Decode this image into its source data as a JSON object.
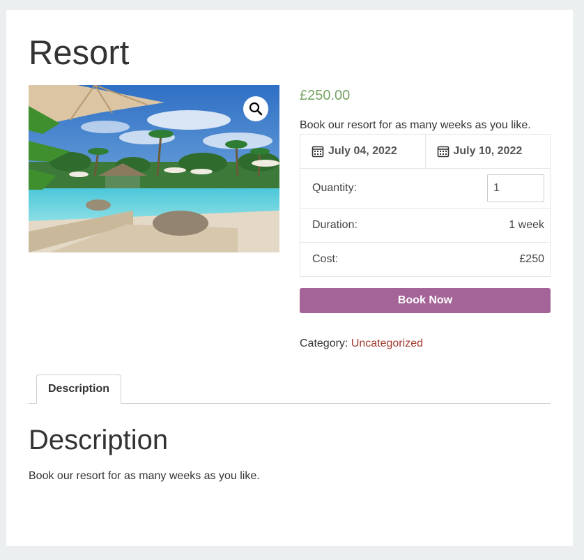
{
  "product": {
    "title": "Resort",
    "price": "£250.00",
    "short_description": "Book our resort for as many weeks as you like.",
    "category_label": "Category:",
    "category_link": "Uncategorized"
  },
  "booking": {
    "start_date": "July 04, 2022",
    "end_date": "July 10, 2022",
    "quantity_label": "Quantity:",
    "quantity_value": "1",
    "duration_label": "Duration:",
    "duration_value": "1 week",
    "cost_label": "Cost:",
    "cost_value": "£250",
    "book_button": "Book Now"
  },
  "tabs": [
    {
      "label": "Description"
    }
  ],
  "description": {
    "heading": "Description",
    "body": "Book our resort for as many weeks as you like."
  },
  "icons": {
    "zoom": "magnifier-icon",
    "calendar": "calendar-icon"
  },
  "colors": {
    "price": "#77a464",
    "button": "#a46497",
    "link": "#a3392f",
    "background": "#eceff0"
  }
}
